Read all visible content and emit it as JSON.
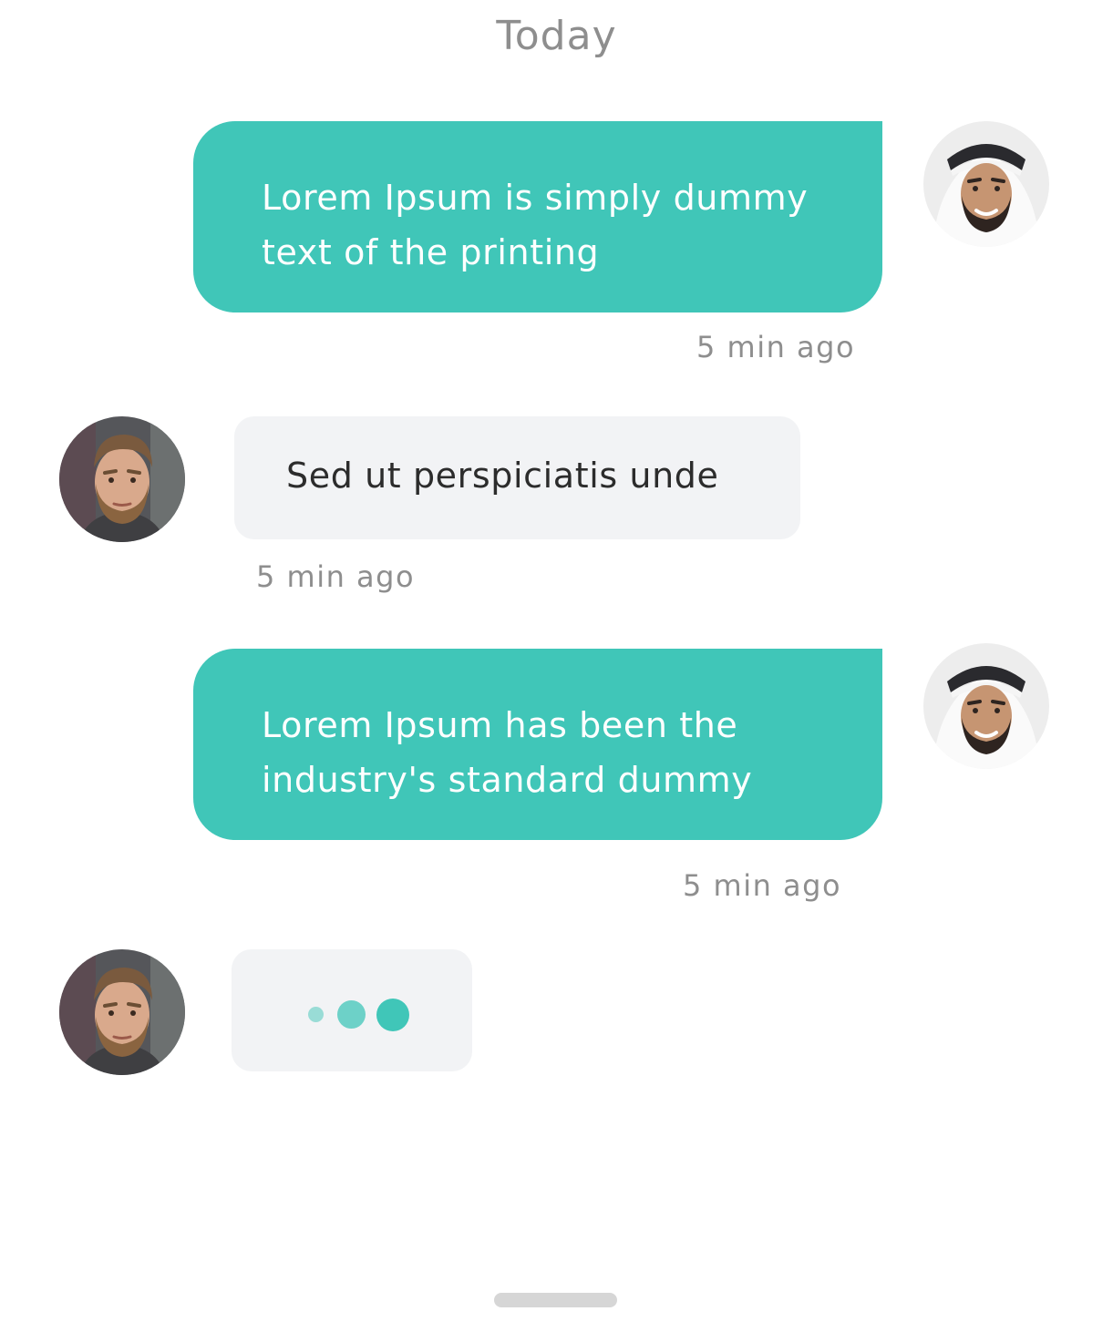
{
  "day_separator": "Today",
  "colors": {
    "accent": "#40c6b8",
    "incoming_bubble": "#f2f3f5",
    "meta_text": "#8e8e8e"
  },
  "messages": [
    {
      "direction": "outgoing",
      "lines": [
        "Lorem Ipsum is simply dummy",
        "text of the printing"
      ],
      "time": "5 min ago",
      "avatar": "sender-avatar"
    },
    {
      "direction": "incoming",
      "lines": [
        "Sed ut perspiciatis unde"
      ],
      "time": "5 min ago",
      "avatar": "contact-avatar"
    },
    {
      "direction": "outgoing",
      "lines": [
        "Lorem Ipsum has been the",
        "industry's standard dummy"
      ],
      "time": "5 min ago",
      "avatar": "sender-avatar"
    }
  ],
  "typing_indicator": {
    "avatar": "contact-avatar",
    "dots": 3
  }
}
